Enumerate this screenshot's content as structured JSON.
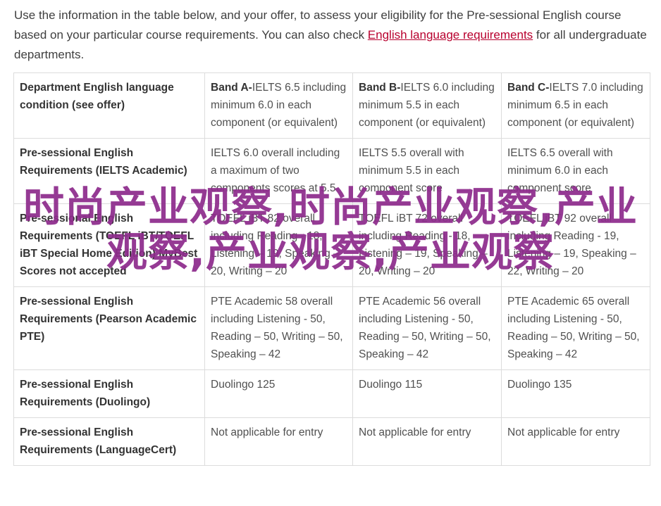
{
  "intro": {
    "text_before": "Use the information in the table below, and your offer, to assess your eligibility for the Pre-sessional English course based on your particular course requirements. You can also check ",
    "link": "English language requirements",
    "text_after": " for all undergraduate departments."
  },
  "table": {
    "header": {
      "label": "Department English language condition (see offer)",
      "bands": [
        {
          "band": "Band A-",
          "detail": "IELTS 6.5 including minimum 6.0 in each component (or equivalent)"
        },
        {
          "band": "Band B-",
          "detail": "IELTS 6.0 including minimum 5.5 in each component (or equivalent)"
        },
        {
          "band": "Band C-",
          "detail": "IELTS 7.0 including minimum 6.5 in each component (or equivalent)"
        }
      ]
    },
    "rows": [
      {
        "label": "Pre-sessional English Requirements (IELTS Academic)",
        "cells": [
          "IELTS 6.0 overall including a maximum of two components scores at 5.5",
          "IELTS 5.5 overall with minimum 5.5 in each component score",
          "IELTS 6.5 overall with minimum 6.0 in each component score"
        ]
      },
      {
        "label": "Pre-sessional English Requirements (TOEFL iBT/TOEFL iBT Special Home Edition) MyBest Scores not accepted",
        "cells": [
          "TOEFL iBT 82 overall including Reading - 18, Listening – 19, Speaking – 20, Writing – 20",
          "TOEFL iBT 72 overall including Reading - 18, Listening – 19, Speaking – 20, Writing – 20",
          "TOEFL iBT 92 overall including Reading - 19, Listening – 19, Speaking – 22, Writing – 20"
        ]
      },
      {
        "label": "Pre-sessional English Requirements (Pearson Academic PTE)",
        "cells": [
          "PTE Academic 58 overall including Listening - 50, Reading – 50, Writing – 50, Speaking – 42",
          "PTE Academic 56 overall including Listening - 50, Reading – 50, Writing – 50, Speaking – 42",
          "PTE Academic 65 overall including Listening - 50, Reading – 50, Writing – 50, Speaking – 42"
        ]
      },
      {
        "label": "Pre-sessional English Requirements (Duolingo)",
        "cells": [
          "Duolingo 125",
          "Duolingo 115",
          "Duolingo 135"
        ]
      },
      {
        "label": "Pre-sessional English Requirements (LanguageCert)",
        "cells": [
          "Not applicable for entry",
          "Not applicable for entry",
          "Not applicable for entry"
        ]
      }
    ]
  },
  "watermark": {
    "text": "时尚产业观察,时尚产业观察,产业观察,产业观察,产业观察"
  }
}
